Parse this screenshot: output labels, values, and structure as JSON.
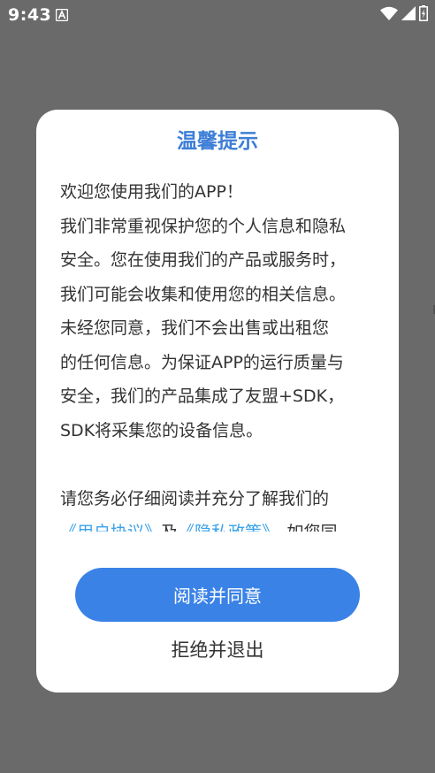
{
  "status_bar": {
    "time": "9:43",
    "icons": [
      "notification-icon",
      "wifi-icon",
      "cellular-signal-icon",
      "battery-icon"
    ]
  },
  "dialog": {
    "title": "温馨提示",
    "lines": [
      "欢迎您使用我们的APP！",
      "我们非常重视保护您的个人信息和隐私",
      "安全。您在使用我们的产品或服务时，",
      "我们可能会收集和使用您的相关信息。",
      "未经您同意，我们不会出售或出租您",
      "的任何信息。为保证APP的运行质量与",
      "安全，我们的产品集成了友盟+SDK，",
      "SDK将采集您的设备信息。"
    ],
    "para2_text": "请您务必仔细阅读并充分了解我们的",
    "user_agreement_link": "《用户协议》",
    "and_text": "及",
    "privacy_policy_link": "《隐私政策》",
    "trailing_text": "，如您同",
    "agree_button": "阅读并同意",
    "decline_button": "拒绝并退出"
  },
  "colors": {
    "overlay": "#6a6a6a",
    "title": "#3d7ed6",
    "link": "#3aa1ea",
    "primary_button": "#3b82e6",
    "body_text": "#333333"
  }
}
